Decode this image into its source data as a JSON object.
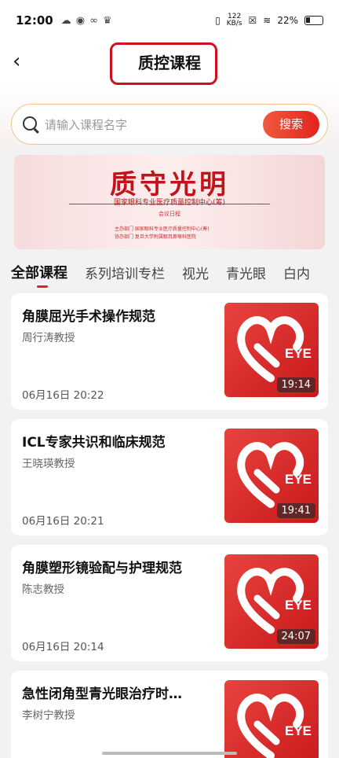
{
  "status_bar": {
    "time": "12:00",
    "net_speed": "122",
    "net_unit": "KB/s",
    "battery": "22%"
  },
  "header": {
    "title": "质控课程"
  },
  "search": {
    "placeholder": "请输入课程名字",
    "button": "搜索"
  },
  "banner": {
    "title": "质守光明",
    "subtitle": "国家眼科专业医疗质量控制中心(筹)",
    "tag": "会议日程",
    "row1": "主办部门  国家眼科专业医疗质量控制中心(筹)",
    "row2": "协办部门  复旦大学附属眼耳鼻喉科医院"
  },
  "tabs": [
    "全部课程",
    "系列培训专栏",
    "视光",
    "青光眼",
    "白内"
  ],
  "courses": [
    {
      "title": "角膜屈光手术操作规范",
      "lecturer": "周行涛教授",
      "date": "06月16日 20:22",
      "duration": "19:14"
    },
    {
      "title": "ICL专家共识和临床规范",
      "lecturer": "王晓瑛教授",
      "date": "06月16日 20:21",
      "duration": "19:41"
    },
    {
      "title": "角膜塑形镜验配与护理规范",
      "lecturer": "陈志教授",
      "date": "06月16日 20:14",
      "duration": "24:07"
    },
    {
      "title": "急性闭角型青光眼治疗时…",
      "lecturer": "李树宁教授",
      "date": "",
      "duration": ""
    }
  ],
  "thumb_label": "EYE",
  "colors": {
    "accent": "#e2231d",
    "highlight_box": "#d0111b"
  }
}
